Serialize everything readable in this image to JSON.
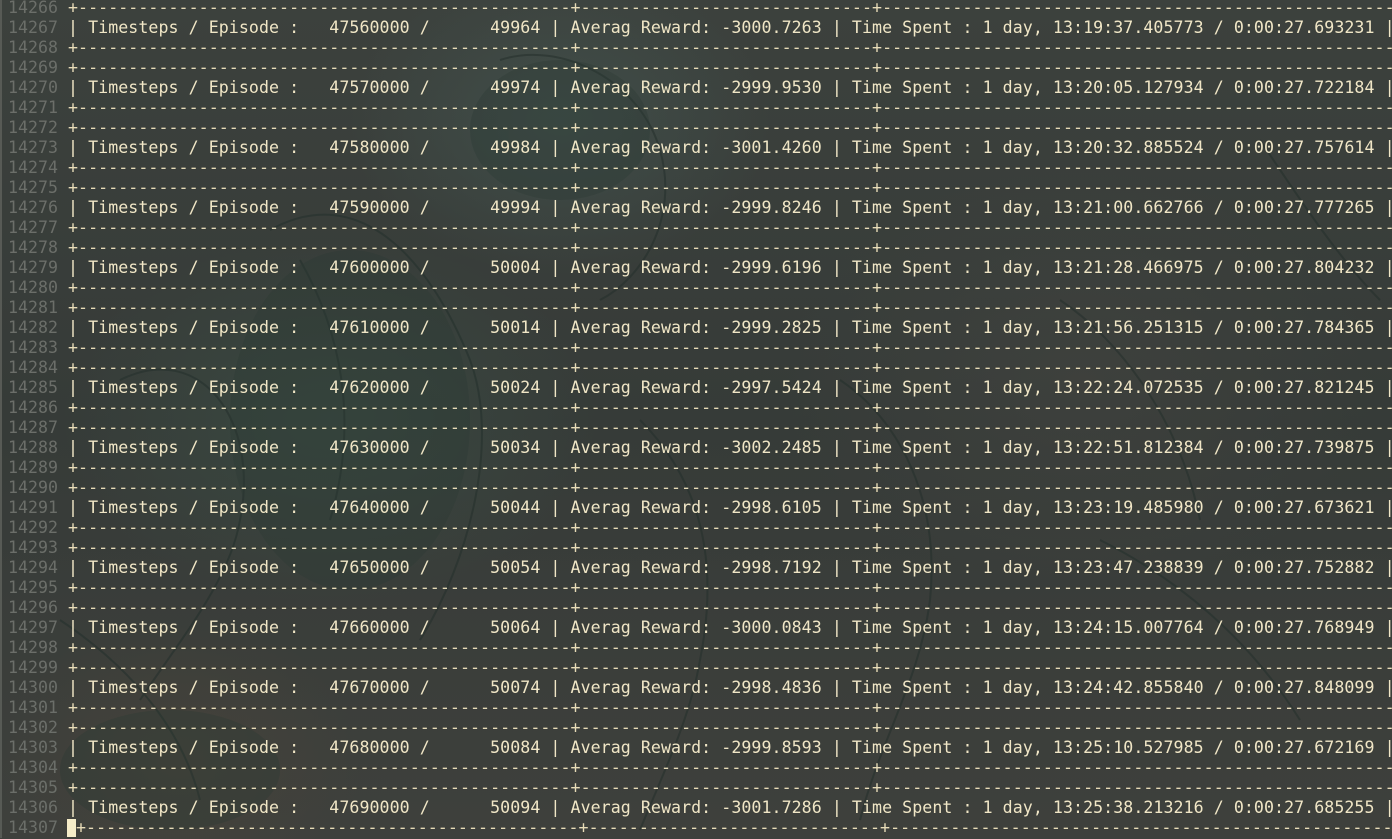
{
  "editor": {
    "lines": [
      {
        "num": "14266",
        "kind": "sep",
        "text": "+-------------------------------------------------+-----------------------------+-----------------------------------------------------------------+"
      },
      {
        "num": "14267",
        "kind": "row",
        "text": "| Timesteps / Episode :   47560000 /      49964 | Averag Reward: -3000.7263 | Time Spent : 1 day, 13:19:37.405773 / 0:00:27.693231 |"
      },
      {
        "num": "14268",
        "kind": "sep",
        "text": "+-------------------------------------------------+-----------------------------+-----------------------------------------------------------------+"
      },
      {
        "num": "14269",
        "kind": "sep",
        "text": "+-------------------------------------------------+-----------------------------+-----------------------------------------------------------------+"
      },
      {
        "num": "14270",
        "kind": "row",
        "text": "| Timesteps / Episode :   47570000 /      49974 | Averag Reward: -2999.9530 | Time Spent : 1 day, 13:20:05.127934 / 0:00:27.722184 |"
      },
      {
        "num": "14271",
        "kind": "sep",
        "text": "+-------------------------------------------------+-----------------------------+-----------------------------------------------------------------+"
      },
      {
        "num": "14272",
        "kind": "sep",
        "text": "+-------------------------------------------------+-----------------------------+-----------------------------------------------------------------+"
      },
      {
        "num": "14273",
        "kind": "row",
        "text": "| Timesteps / Episode :   47580000 /      49984 | Averag Reward: -3001.4260 | Time Spent : 1 day, 13:20:32.885524 / 0:00:27.757614 |"
      },
      {
        "num": "14274",
        "kind": "sep",
        "text": "+-------------------------------------------------+-----------------------------+-----------------------------------------------------------------+"
      },
      {
        "num": "14275",
        "kind": "sep",
        "text": "+-------------------------------------------------+-----------------------------+-----------------------------------------------------------------+"
      },
      {
        "num": "14276",
        "kind": "row",
        "text": "| Timesteps / Episode :   47590000 /      49994 | Averag Reward: -2999.8246 | Time Spent : 1 day, 13:21:00.662766 / 0:00:27.777265 |"
      },
      {
        "num": "14277",
        "kind": "sep",
        "text": "+-------------------------------------------------+-----------------------------+-----------------------------------------------------------------+"
      },
      {
        "num": "14278",
        "kind": "sep",
        "text": "+-------------------------------------------------+-----------------------------+-----------------------------------------------------------------+"
      },
      {
        "num": "14279",
        "kind": "row",
        "text": "| Timesteps / Episode :   47600000 /      50004 | Averag Reward: -2999.6196 | Time Spent : 1 day, 13:21:28.466975 / 0:00:27.804232 |"
      },
      {
        "num": "14280",
        "kind": "sep",
        "text": "+-------------------------------------------------+-----------------------------+-----------------------------------------------------------------+"
      },
      {
        "num": "14281",
        "kind": "sep",
        "text": "+-------------------------------------------------+-----------------------------+-----------------------------------------------------------------+"
      },
      {
        "num": "14282",
        "kind": "row",
        "text": "| Timesteps / Episode :   47610000 /      50014 | Averag Reward: -2999.2825 | Time Spent : 1 day, 13:21:56.251315 / 0:00:27.784365 |"
      },
      {
        "num": "14283",
        "kind": "sep",
        "text": "+-------------------------------------------------+-----------------------------+-----------------------------------------------------------------+"
      },
      {
        "num": "14284",
        "kind": "sep",
        "text": "+-------------------------------------------------+-----------------------------+-----------------------------------------------------------------+"
      },
      {
        "num": "14285",
        "kind": "row",
        "text": "| Timesteps / Episode :   47620000 /      50024 | Averag Reward: -2997.5424 | Time Spent : 1 day, 13:22:24.072535 / 0:00:27.821245 |"
      },
      {
        "num": "14286",
        "kind": "sep",
        "text": "+-------------------------------------------------+-----------------------------+-----------------------------------------------------------------+"
      },
      {
        "num": "14287",
        "kind": "sep",
        "text": "+-------------------------------------------------+-----------------------------+-----------------------------------------------------------------+"
      },
      {
        "num": "14288",
        "kind": "row",
        "text": "| Timesteps / Episode :   47630000 /      50034 | Averag Reward: -3002.2485 | Time Spent : 1 day, 13:22:51.812384 / 0:00:27.739875 |"
      },
      {
        "num": "14289",
        "kind": "sep",
        "text": "+-------------------------------------------------+-----------------------------+-----------------------------------------------------------------+"
      },
      {
        "num": "14290",
        "kind": "sep",
        "text": "+-------------------------------------------------+-----------------------------+-----------------------------------------------------------------+"
      },
      {
        "num": "14291",
        "kind": "row",
        "text": "| Timesteps / Episode :   47640000 /      50044 | Averag Reward: -2998.6105 | Time Spent : 1 day, 13:23:19.485980 / 0:00:27.673621 |"
      },
      {
        "num": "14292",
        "kind": "sep",
        "text": "+-------------------------------------------------+-----------------------------+-----------------------------------------------------------------+"
      },
      {
        "num": "14293",
        "kind": "sep",
        "text": "+-------------------------------------------------+-----------------------------+-----------------------------------------------------------------+"
      },
      {
        "num": "14294",
        "kind": "row",
        "text": "| Timesteps / Episode :   47650000 /      50054 | Averag Reward: -2998.7192 | Time Spent : 1 day, 13:23:47.238839 / 0:00:27.752882 |"
      },
      {
        "num": "14295",
        "kind": "sep",
        "text": "+-------------------------------------------------+-----------------------------+-----------------------------------------------------------------+"
      },
      {
        "num": "14296",
        "kind": "sep",
        "text": "+-------------------------------------------------+-----------------------------+-----------------------------------------------------------------+"
      },
      {
        "num": "14297",
        "kind": "row",
        "text": "| Timesteps / Episode :   47660000 /      50064 | Averag Reward: -3000.0843 | Time Spent : 1 day, 13:24:15.007764 / 0:00:27.768949 |"
      },
      {
        "num": "14298",
        "kind": "sep",
        "text": "+-------------------------------------------------+-----------------------------+-----------------------------------------------------------------+"
      },
      {
        "num": "14299",
        "kind": "sep",
        "text": "+-------------------------------------------------+-----------------------------+-----------------------------------------------------------------+"
      },
      {
        "num": "14300",
        "kind": "row",
        "text": "| Timesteps / Episode :   47670000 /      50074 | Averag Reward: -2998.4836 | Time Spent : 1 day, 13:24:42.855840 / 0:00:27.848099 |"
      },
      {
        "num": "14301",
        "kind": "sep",
        "text": "+-------------------------------------------------+-----------------------------+-----------------------------------------------------------------+"
      },
      {
        "num": "14302",
        "kind": "sep",
        "text": "+-------------------------------------------------+-----------------------------+-----------------------------------------------------------------+"
      },
      {
        "num": "14303",
        "kind": "row",
        "text": "| Timesteps / Episode :   47680000 /      50084 | Averag Reward: -2999.8593 | Time Spent : 1 day, 13:25:10.527985 / 0:00:27.672169 |"
      },
      {
        "num": "14304",
        "kind": "sep",
        "text": "+-------------------------------------------------+-----------------------------+-----------------------------------------------------------------+"
      },
      {
        "num": "14305",
        "kind": "sep",
        "text": "+-------------------------------------------------+-----------------------------+-----------------------------------------------------------------+"
      },
      {
        "num": "14306",
        "kind": "row",
        "text": "| Timesteps / Episode :   47690000 /      50094 | Averag Reward: -3001.7286 | Time Spent : 1 day, 13:25:38.213216 / 0:00:27.685255 |"
      },
      {
        "num": "14307",
        "kind": "cursor",
        "text": "+-------------------------------------------------+-----------------------------+-----------------------------------------------------------------+"
      }
    ]
  },
  "colors": {
    "text": "#f0e6c6",
    "line_number": "#6b6e69",
    "cursor": "#f5ecc8"
  }
}
